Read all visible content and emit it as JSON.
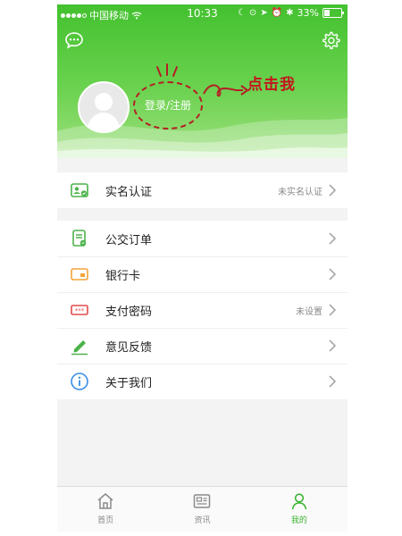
{
  "status_bar": {
    "carrier": "中国移动",
    "time": "10:33",
    "battery": "33%",
    "battery_level": 0.33
  },
  "header": {
    "login_label": "登录/注册",
    "annotation_text": "点击我"
  },
  "menu_top": [
    {
      "label": "实名认证",
      "value": "未实名认证",
      "icon": "id-card-icon"
    }
  ],
  "menu_main": [
    {
      "label": "公交订单",
      "value": "",
      "icon": "order-icon"
    },
    {
      "label": "银行卡",
      "value": "",
      "icon": "bank-card-icon"
    },
    {
      "label": "支付密码",
      "value": "未设置",
      "icon": "password-icon"
    },
    {
      "label": "意见反馈",
      "value": "",
      "icon": "feedback-pen-icon"
    },
    {
      "label": "关于我们",
      "value": "",
      "icon": "info-icon"
    }
  ],
  "tab_bar": {
    "items": [
      {
        "label": "首页",
        "icon": "home-icon",
        "active": false
      },
      {
        "label": "资讯",
        "icon": "news-icon",
        "active": false
      },
      {
        "label": "我的",
        "icon": "person-icon",
        "active": true
      }
    ]
  },
  "colors": {
    "brand_green": "#3bb431",
    "annotation_red": "#c3141d",
    "order_icon": "#4cb34a",
    "bank_icon": "#f2a33a",
    "password_icon": "#e24b4b",
    "info_icon": "#3a8ee6"
  }
}
